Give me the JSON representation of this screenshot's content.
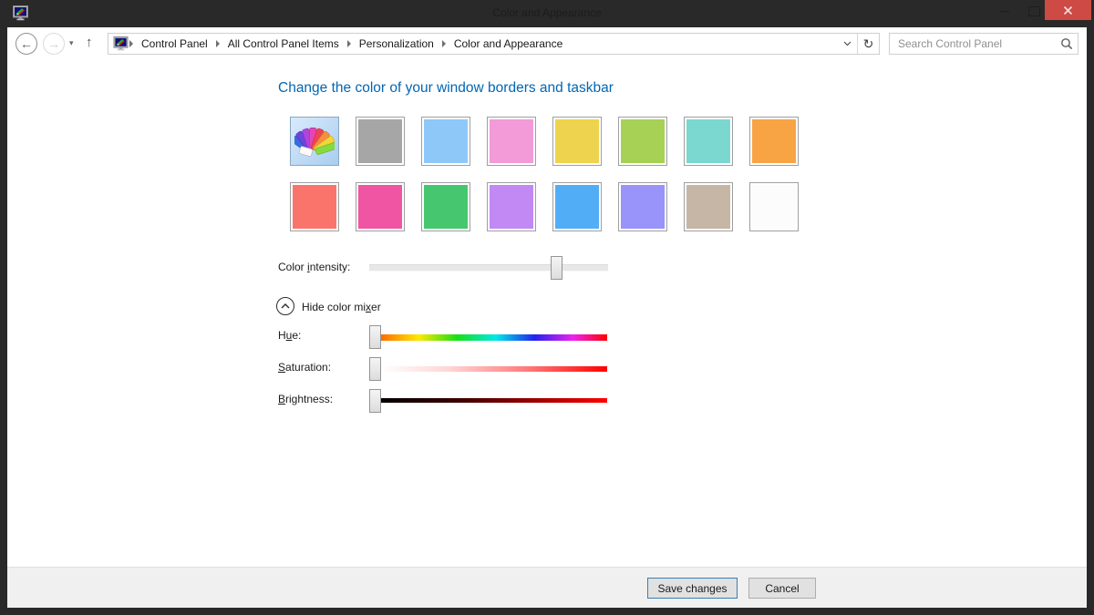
{
  "titlebar": {
    "title": "Color and Appearance"
  },
  "icons": {
    "back": "←",
    "forward": "→",
    "dropdown": "▾",
    "up": "↑",
    "refresh": "↻"
  },
  "navbar": {
    "breadcrumb": [
      "Control Panel",
      "All Control Panel Items",
      "Personalization",
      "Color and Appearance"
    ],
    "search": {
      "placeholder": "Search Control Panel"
    }
  },
  "content": {
    "heading": "Change the color of your window borders and taskbar",
    "heading_color": "#0066b4",
    "swatches": {
      "selected_index": 0,
      "colors": [
        "#a6a6a6",
        "#8ec8f8",
        "#f39ad8",
        "#eed44e",
        "#a6d155",
        "#7ad8d0",
        "#f8a445",
        "#fa746b",
        "#ef55a2",
        "#46c76f",
        "#c289f4",
        "#52adf7",
        "#9894fa",
        "#c5b6a6",
        "#fcfcfc"
      ]
    },
    "intensity": {
      "label_pre": "Color ",
      "label_key": "i",
      "label_post": "ntensity:",
      "thumb_percent": 80
    },
    "mixer_toggle": {
      "label_pre": "Hide color mi",
      "label_key": "x",
      "label_post": "er"
    },
    "hue": {
      "label_pre": "H",
      "label_key": "u",
      "label_post": "e:",
      "thumb_percent": 0
    },
    "saturation": {
      "label_pre": "",
      "label_key": "S",
      "label_post": "aturation:",
      "thumb_percent": 0
    },
    "brightness": {
      "label_pre": "",
      "label_key": "B",
      "label_post": "rightness:",
      "thumb_percent": 0
    }
  },
  "footer": {
    "save_label": "Save changes",
    "cancel_label": "Cancel",
    "save_border_color": "#3c7fb1"
  },
  "colors": {
    "titlebar_bg": "#292929",
    "close_button": "#cd4a45",
    "content_bg": "#ffffff",
    "footer_bg": "#f0f0f0"
  }
}
